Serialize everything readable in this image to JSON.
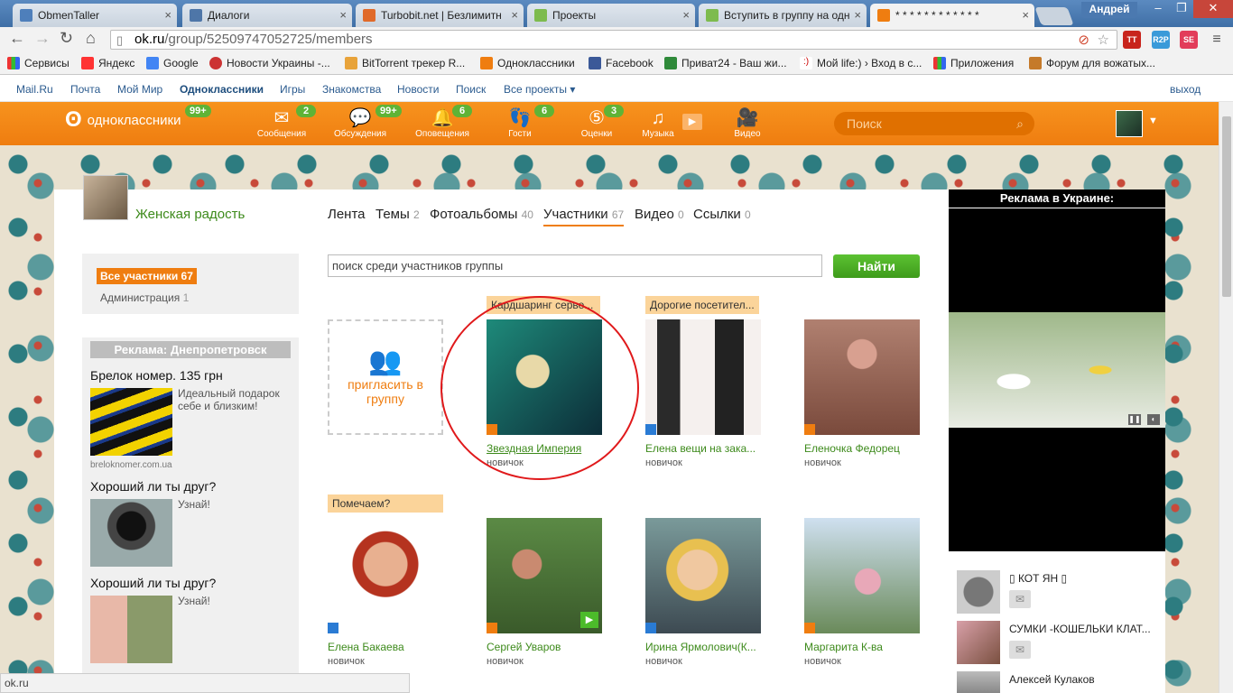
{
  "browser": {
    "tabs": [
      {
        "title": "ObmenTaller",
        "color": "#4e7fbb"
      },
      {
        "title": "Диалоги",
        "color": "#4e76a8"
      },
      {
        "title": "Turbobit.net | Безлимитн",
        "color": "#e06a2a"
      },
      {
        "title": "Проекты",
        "color": "#7dbb4e"
      },
      {
        "title": "Вступить в группу на одн",
        "color": "#7dbb4e"
      },
      {
        "title": "* * * * * * * * * * * *",
        "color": "#ef7d10"
      }
    ],
    "user": "Андрей",
    "url_host": "ok.ru",
    "url_path": "/group/52509747052725/members",
    "bookmarks": [
      "Сервисы",
      "Яндекс",
      "Google",
      "Новости Украины -...",
      "BitTorrent трекер R...",
      "Одноклассники",
      "Facebook",
      "Приват24 - Ваш жи...",
      "Мой life:) › Вход в с...",
      "Приложения",
      "Форум для вожатых..."
    ],
    "status": "ok.ru"
  },
  "mailbar": {
    "links": [
      "Mail.Ru",
      "Почта",
      "Мой Мир",
      "Одноклассники",
      "Игры",
      "Знакомства",
      "Новости",
      "Поиск",
      "Все проекты ▾"
    ],
    "logout": "выход"
  },
  "header": {
    "logo": "одноклассники",
    "logo_badge": "99+",
    "nav": [
      {
        "label": "Сообщения",
        "badge": "2",
        "icon": "envelope-icon"
      },
      {
        "label": "Обсуждения",
        "badge": "99+",
        "icon": "chat-icon"
      },
      {
        "label": "Оповещения",
        "badge": "6",
        "icon": "bell-icon"
      },
      {
        "label": "Гости",
        "badge": "6",
        "icon": "footprints-icon"
      },
      {
        "label": "Оценки",
        "badge": "3",
        "icon": "rating-icon"
      },
      {
        "label": "Музыка",
        "badge": "",
        "icon": "music-icon"
      },
      {
        "label": "Видео",
        "badge": "",
        "icon": "video-icon"
      }
    ],
    "search_placeholder": "Поиск"
  },
  "group": {
    "name": "Женская радость",
    "tabs": [
      {
        "label": "Лента",
        "count": ""
      },
      {
        "label": "Темы",
        "count": "2"
      },
      {
        "label": "Фотоальбомы",
        "count": "40"
      },
      {
        "label": "Участники",
        "count": "67"
      },
      {
        "label": "Видео",
        "count": "0"
      },
      {
        "label": "Ссылки",
        "count": "0"
      }
    ],
    "filters": {
      "all": "Все участники 67",
      "admin": "Администрация",
      "admin_count": "1"
    },
    "search_placeholder": "поиск среди участников группы",
    "find_button": "Найти",
    "invite": "пригласить в группу"
  },
  "members": [
    {
      "name": "Звездная Империя",
      "rank": "новичок",
      "tag": "Кардшаринг серве..."
    },
    {
      "name": "Елена вещи на зака...",
      "rank": "новичок",
      "tag": "Дорогие посетител..."
    },
    {
      "name": "Еленочка Федорец",
      "rank": "новичок",
      "tag": ""
    },
    {
      "name": "Елена Бакаева",
      "rank": "новичок",
      "tag": "Помечаем?"
    },
    {
      "name": "Сергей Уваров",
      "rank": "новичок",
      "tag": ""
    },
    {
      "name": "Ирина Ярмолович(К...",
      "rank": "новичок",
      "tag": ""
    },
    {
      "name": "Маргарита К-ва",
      "rank": "новичок",
      "tag": ""
    }
  ],
  "left_ads": {
    "title": "Реклама: Днепропетровск",
    "items": [
      {
        "head": "Брелок номер. 135 грн",
        "text": "Идеальный подарок себе и близким!",
        "source": "breloknomer.com.ua"
      },
      {
        "head": "Хороший ли ты друг?",
        "text": "Узнай!"
      },
      {
        "head": "Хороший ли ты друг?",
        "text": "Узнай!"
      }
    ]
  },
  "right_ad": {
    "title": "Реклама в Украине:"
  },
  "friends": [
    {
      "name": "▯ КОТ ЯН ▯"
    },
    {
      "name": "СУМКИ -КОШЕЛЬКИ КЛАТ..."
    },
    {
      "name": "Алексей Кулаков"
    }
  ]
}
